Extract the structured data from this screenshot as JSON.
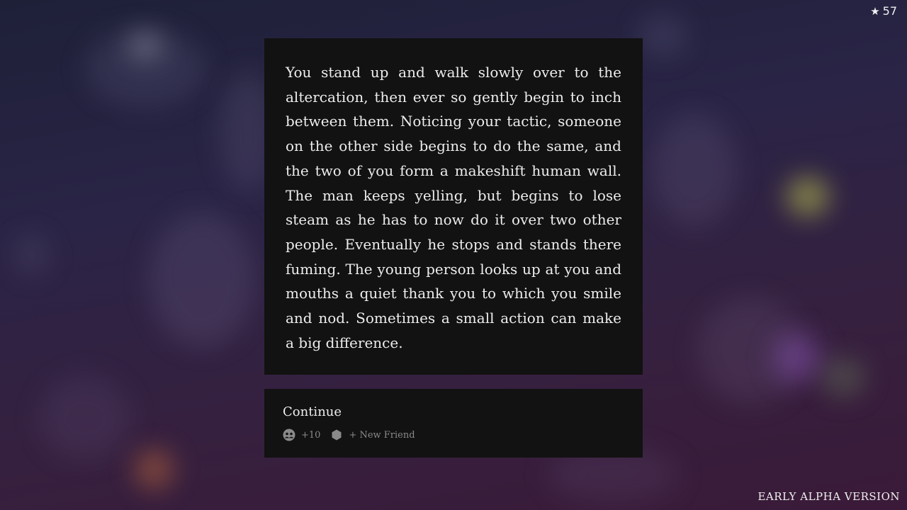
{
  "colors": {
    "background_top": "#1e2038",
    "background_bottom": "#3a1a38",
    "card": "#121212",
    "text": "#ededed",
    "muted": "#8a8a8a"
  },
  "hud": {
    "star_icon": "star-icon",
    "score": "57"
  },
  "story": {
    "text": "You stand up and walk slowly over to the altercation, then ever so gently begin to inch between them. Noticing your tactic, someone on the other side begins to do the same, and the two of you form a makeshift human wall. The man keeps yelling, but begins to lose steam as he has to now do it over two other people. Eventually he stops and stands there fuming. The young person looks up at you and mouths a quiet thank you to which you smile and nod. Sometimes a small action can make a big difference."
  },
  "choice": {
    "label": "Continue",
    "effects": [
      {
        "icon": "people-icon",
        "text": "+10"
      },
      {
        "icon": "hexagon-icon",
        "text": "+ New Friend"
      }
    ]
  },
  "footer": {
    "version": "EARLY ALPHA VERSION"
  }
}
